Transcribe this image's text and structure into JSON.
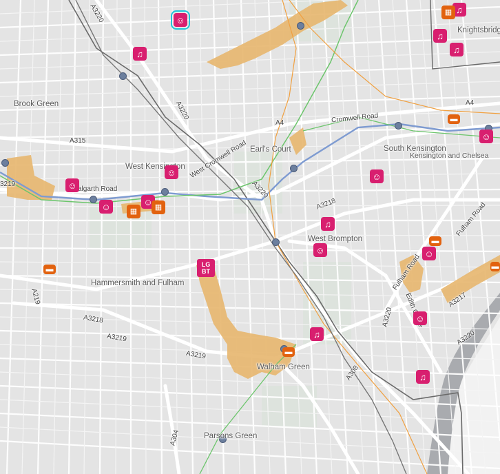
{
  "map": {
    "areas": {
      "brook_green": "Brook Green",
      "west_kensington": "West Kensington",
      "earls_court": "Earl's Court",
      "south_kensington": "South Kensington",
      "kensington_chelsea": "Kensington and Chelsea",
      "knightsbridge": "Knightsbridge",
      "west_brompton": "West Brompton",
      "hammersmith_fulham": "Hammersmith and Fulham",
      "walham_green": "Walham Green",
      "parsons_green": "Parsons Green"
    },
    "roads": {
      "a3220_top": "A3220",
      "a3220_mid": "A3220",
      "a3220_lower": "A3220",
      "a3220_right": "A3220",
      "a3220_se": "A3220",
      "a4_top": "A4",
      "a4_mid": "A4",
      "a315": "A315",
      "cromwell_road": "Cromwell Road",
      "west_cromwell_road": "West Cromwell Road",
      "talgarth_road": "Talgarth Road",
      "a3218_top": "A3218",
      "a3218_left": "A3218",
      "a3219_left": "A3219",
      "a3219_mid": "A3219",
      "a3219_edge": "3219",
      "a219": "A219",
      "a304": "A304",
      "a308": "A308",
      "a3217": "A3217",
      "fulham_road_1": "Fulham Road",
      "fulham_road_2": "Fulham Road",
      "edith_grove": "Edith Grove",
      "a308_right": "8"
    },
    "lgbt_badge": {
      "line1": "LG",
      "line2": "BT"
    },
    "colors": {
      "background": "#e6e6e6",
      "road": "#ffffff",
      "highlight": "#e7b66e",
      "rail_blue": "#7e9bd1",
      "rail_green": "#6cc56c",
      "rail_orange": "#f0a040",
      "rail_grey": "#666666",
      "water": "#a7a9ad",
      "poi_pink": "#d81f6f",
      "poi_orange": "#e2620f",
      "selection": "#22c4d8"
    }
  }
}
